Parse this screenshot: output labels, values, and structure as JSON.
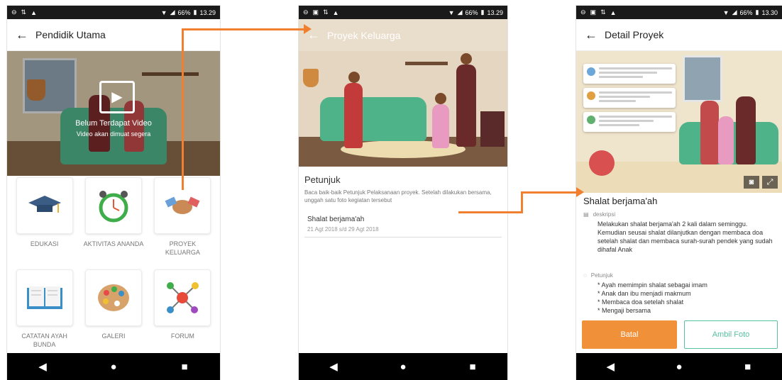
{
  "status_bar": {
    "screen1": {
      "battery": "66%",
      "time": "13.29"
    },
    "screen2": {
      "battery": "66%",
      "time": "13.29"
    },
    "screen3": {
      "battery": "66%",
      "time": "13.30"
    }
  },
  "screen1": {
    "title": "Pendidik Utama",
    "video": {
      "title": "Belum Terdapat Video",
      "subtitle": "Video akan dimuat segera"
    },
    "tiles": [
      {
        "label": "EDUKASI",
        "icon": "graduation-cap-icon"
      },
      {
        "label": "AKTIVITAS ANANDA",
        "icon": "alarm-clock-icon"
      },
      {
        "label": "PROYEK KELUARGA",
        "icon": "handshake-icon"
      },
      {
        "label": "CATATAN AYAH BUNDA",
        "icon": "open-book-icon"
      },
      {
        "label": "GALERI",
        "icon": "palette-icon"
      },
      {
        "label": "FORUM",
        "icon": "network-icon"
      }
    ]
  },
  "screen2": {
    "title": "Proyek Keluarga",
    "petunjuk_title": "Petunjuk",
    "petunjuk_text": "Baca baik-baik Petunjuk Pelaksanaan proyek. Setelah dilakukan bersama, unggah satu foto kegiatan tersebut",
    "activity": {
      "name": "Shalat berjama'ah",
      "date": "21 Agt 2018 s/d 29 Agt 2018"
    }
  },
  "screen3": {
    "title": "Detail Proyek",
    "project_name": "Shalat berjama'ah",
    "deskripsi_label": "deskripsi",
    "deskripsi_text": "Melakukan shalat berjama'ah 2 kali dalam seminggu. Kemudian seusai shalat dilanjutkan dengan membaca doa setelah shalat dan membaca surah-surah pendek yang sudah dihafal Anak",
    "petunjuk_label": "Petunjuk",
    "petunjuk_items": [
      "* Ayah memimpin shalat sebagai imam",
      "* Anak dan ibu menjadi makmum",
      "* Membaca doa setelah shalat",
      "* Mengaji bersama"
    ],
    "cancel_label": "Batal",
    "photo_label": "Ambil Foto"
  },
  "colors": {
    "accent_orange": "#f08030",
    "teal": "#55c1a0",
    "dark_bar": "#000000"
  }
}
